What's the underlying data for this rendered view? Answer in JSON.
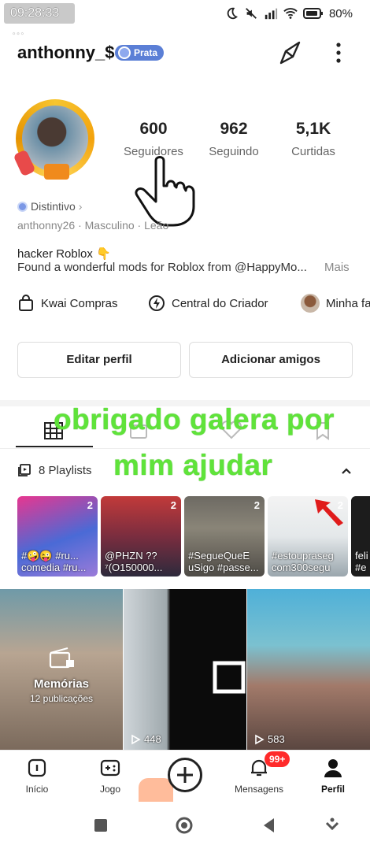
{
  "status": {
    "time": "09:28:33",
    "dots": "···",
    "battery_percent": "80%"
  },
  "profile": {
    "username": "anthonny_$",
    "badge": "Prata",
    "stats": [
      {
        "value": "600",
        "label": "Seguidores"
      },
      {
        "value": "962",
        "label": "Seguindo"
      },
      {
        "value": "5,1K",
        "label": "Curtidas"
      }
    ],
    "distintivo": "Distintivo",
    "meta": "anthonny26 · Masculino · Leão",
    "bio_line1": "hacker Roblox 👇",
    "bio_line2": "Found a wonderful mods for Roblox from @HappyMo...",
    "bio_more": "Mais"
  },
  "shortcuts": [
    {
      "label": "Kwai Compras",
      "icon": "bag-icon"
    },
    {
      "label": "Central do Criador",
      "icon": "bolt-icon"
    },
    {
      "label": "Minha fa",
      "icon": "avatar"
    }
  ],
  "buttons": {
    "edit": "Editar perfil",
    "add": "Adicionar amigos"
  },
  "overlay": {
    "line1": "obrigado galera por",
    "line2": "mim ajudar"
  },
  "playlists": {
    "header": "8 Playlists",
    "items": [
      {
        "count": "2",
        "title": "#🤪😜 #ru... comedia #ru..."
      },
      {
        "count": "2",
        "title": "@PHZN ??⁷(O150000..."
      },
      {
        "count": "2",
        "title": "#SegueQueE uSigo #passe..."
      },
      {
        "count": "2",
        "title": "#estoupraseg com300segu"
      },
      {
        "count": "",
        "title": "feli #e"
      }
    ]
  },
  "grid": {
    "memories_title": "Memórias",
    "memories_sub": "12 publicações",
    "views": [
      "448",
      "583"
    ]
  },
  "nav": {
    "items": [
      "Início",
      "Jogo",
      "Mensagens",
      "Perfil"
    ],
    "notif_count": "99+"
  },
  "colors": {
    "accent_blue": "#5b7fd6",
    "overlay_green": "#5fe33a",
    "notif_red": "#ff2a2a"
  }
}
